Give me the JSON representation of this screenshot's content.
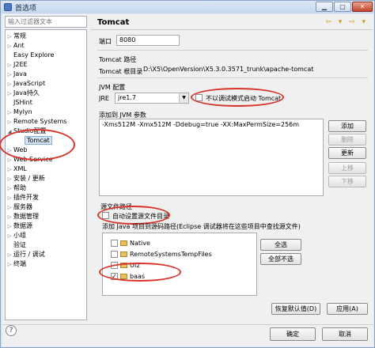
{
  "window": {
    "title": "首选项"
  },
  "filter": {
    "placeholder": "输入过滤器文本"
  },
  "tree": {
    "items": [
      {
        "label": "常规",
        "expandable": true
      },
      {
        "label": "Ant",
        "expandable": true
      },
      {
        "label": "Easy Explore",
        "expandable": false
      },
      {
        "label": "J2EE",
        "expandable": true
      },
      {
        "label": "Java",
        "expandable": true
      },
      {
        "label": "JavaScript",
        "expandable": true
      },
      {
        "label": "Java持久",
        "expandable": true
      },
      {
        "label": "JSHint",
        "expandable": false
      },
      {
        "label": "Mylyn",
        "expandable": true
      },
      {
        "label": "Remote Systems",
        "expandable": true
      },
      {
        "label": "Studio配置",
        "expandable": true,
        "expanded": true
      },
      {
        "label": "Tomcat",
        "expandable": false,
        "child": true,
        "selected": true
      },
      {
        "label": "Web",
        "expandable": true
      },
      {
        "label": "Web Service",
        "expandable": true
      },
      {
        "label": "XML",
        "expandable": true
      },
      {
        "label": "安装 / 更新",
        "expandable": true
      },
      {
        "label": "帮助",
        "expandable": true
      },
      {
        "label": "插件开发",
        "expandable": true
      },
      {
        "label": "服务器",
        "expandable": true
      },
      {
        "label": "数据管理",
        "expandable": true
      },
      {
        "label": "数据源",
        "expandable": true
      },
      {
        "label": "小组",
        "expandable": true
      },
      {
        "label": "验证",
        "expandable": false
      },
      {
        "label": "运行 / 调试",
        "expandable": true
      },
      {
        "label": "终端",
        "expandable": true
      }
    ]
  },
  "help": {
    "icon": "?"
  },
  "panel": {
    "title": "Tomcat",
    "nav_icons": "⇦ ▾ ⇨ ▾",
    "port_label": "端口",
    "port_value": "8080",
    "path_section": "Tomcat 路径",
    "root_label": "Tomcat 根目录",
    "root_value": "D:\\X5\\OpenVersion\\X5.3.0.3571_trunk\\apache-tomcat",
    "jvm_section": "JVM 配置",
    "jre_label": "JRE",
    "jre_value": "jre1.7",
    "debug_checkbox_label": "不以调试模式启动 Tomcat",
    "jvm_params_label": "添加到 JVM 参数",
    "jvm_params_value": "-Xms512M -Xmx512M -Ddebug=true -XX:MaxPermSize=256m",
    "buttons": {
      "add": "添加",
      "delete": "删除",
      "update": "更新",
      "up": "上移",
      "down": "下移"
    },
    "source_group": "源文件路径",
    "auto_source_label": "自动设置源文件目录",
    "projects_label": "添加 Java 项目到源码路径(Eclipse 调试器将在这些项目中查找源文件)",
    "projects": [
      {
        "name": "Native",
        "checked": false
      },
      {
        "name": "RemoteSystemsTempFiles",
        "checked": false
      },
      {
        "name": "UI2",
        "checked": false
      },
      {
        "name": "baas",
        "checked": true
      }
    ],
    "select_all": "全选",
    "deselect_all": "全部不选",
    "restore_defaults": "恢复默认值(D)",
    "apply": "应用(A)"
  },
  "footer": {
    "ok": "确定",
    "cancel": "取消"
  },
  "annotation_color": "#d8342a"
}
